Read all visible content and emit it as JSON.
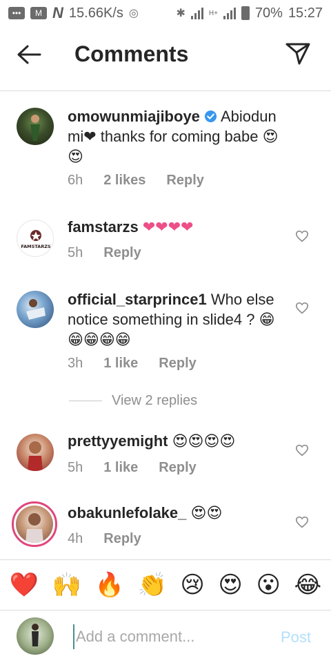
{
  "status_bar": {
    "speed": "15.66K/s",
    "network_label": "H+",
    "battery": "70%",
    "time": "15:27"
  },
  "header": {
    "title": "Comments"
  },
  "comments": [
    {
      "username": "omowunmiajiboye",
      "verified": true,
      "text": "Abiodun mi❤ thanks for coming babe 😍😍",
      "time": "6h",
      "likes": "2 likes",
      "reply": "Reply"
    },
    {
      "username": "famstarzs",
      "avatar_text": "FAMSTARZS",
      "text": "❤❤❤❤",
      "time": "5h",
      "reply": "Reply"
    },
    {
      "username": "official_starprince1",
      "text": "Who else notice something in slide4 ? 😁😁😁😁😁",
      "time": "3h",
      "likes": "1 like",
      "reply": "Reply"
    },
    {
      "username": "prettyyemight",
      "text": "😍😍😍😍",
      "time": "5h",
      "likes": "1 like",
      "reply": "Reply"
    },
    {
      "username": "obakunlefolake_",
      "text": "😍😍",
      "time": "4h",
      "reply": "Reply"
    }
  ],
  "view_replies": "View 2 replies",
  "quick_emojis": [
    "❤️",
    "🙌",
    "🔥",
    "👏",
    "😢",
    "😍",
    "😮",
    "😂"
  ],
  "comment_input": {
    "placeholder": "Add a comment...",
    "post_label": "Post"
  },
  "icons": {
    "back": "back-arrow-icon",
    "send": "send-icon",
    "like": "heart-outline-icon",
    "verified": "verified-badge-icon"
  },
  "colors": {
    "verified": "#3897f0",
    "post_disabled": "#b2dffc",
    "story_ring": "#e0457b",
    "heart": "#ed4f88"
  }
}
